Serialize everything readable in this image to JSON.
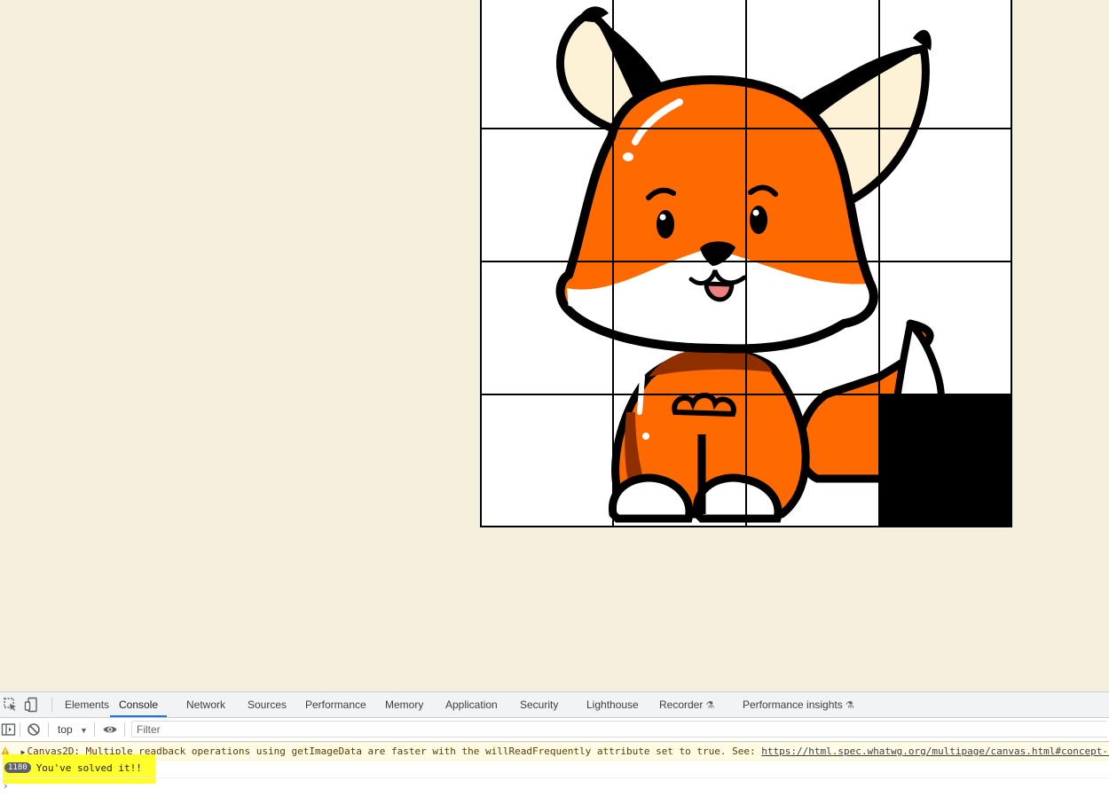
{
  "puzzle": {
    "rows": 4,
    "cols": 4,
    "empty_tile": {
      "row": 3,
      "col": 3
    },
    "colors": {
      "fox_orange": "#ff6a00",
      "fox_dark_orange": "#8f2f00",
      "ear_inner": "#fdf1d6",
      "outline": "#000000",
      "tile_bg": "#ffffff",
      "nose": "#000000",
      "tongue": "#f08080"
    }
  },
  "devtools": {
    "tabs": [
      {
        "label": "Elements"
      },
      {
        "label": "Console",
        "active": true
      },
      {
        "label": "Network"
      },
      {
        "label": "Sources"
      },
      {
        "label": "Performance"
      },
      {
        "label": "Memory"
      },
      {
        "label": "Application"
      },
      {
        "label": "Security"
      },
      {
        "label": "Lighthouse"
      },
      {
        "label": "Recorder",
        "experimental": true
      },
      {
        "label": "Performance insights",
        "experimental": true
      }
    ],
    "toolbar": {
      "context": "top",
      "filter_placeholder": "Filter"
    },
    "console": {
      "warning": {
        "text": "Canvas2D: Multiple readback operations using getImageData are faster with the willReadFrequently attribute set to true. See: ",
        "link": "https://html.spec.whatwg.org/multipage/canvas.html#concept-canvas-will-read-frequently"
      },
      "log": {
        "count": "1180",
        "text": "You've solved it!!"
      },
      "prompt": "›"
    },
    "icons": {
      "inspect": "inspect-element-icon",
      "device": "device-toggle-icon",
      "sidebar": "console-sidebar-icon",
      "clear": "clear-console-icon",
      "eye": "live-expression-eye-icon",
      "warning": "warning-icon",
      "flask": "experimental-flask-icon"
    }
  }
}
